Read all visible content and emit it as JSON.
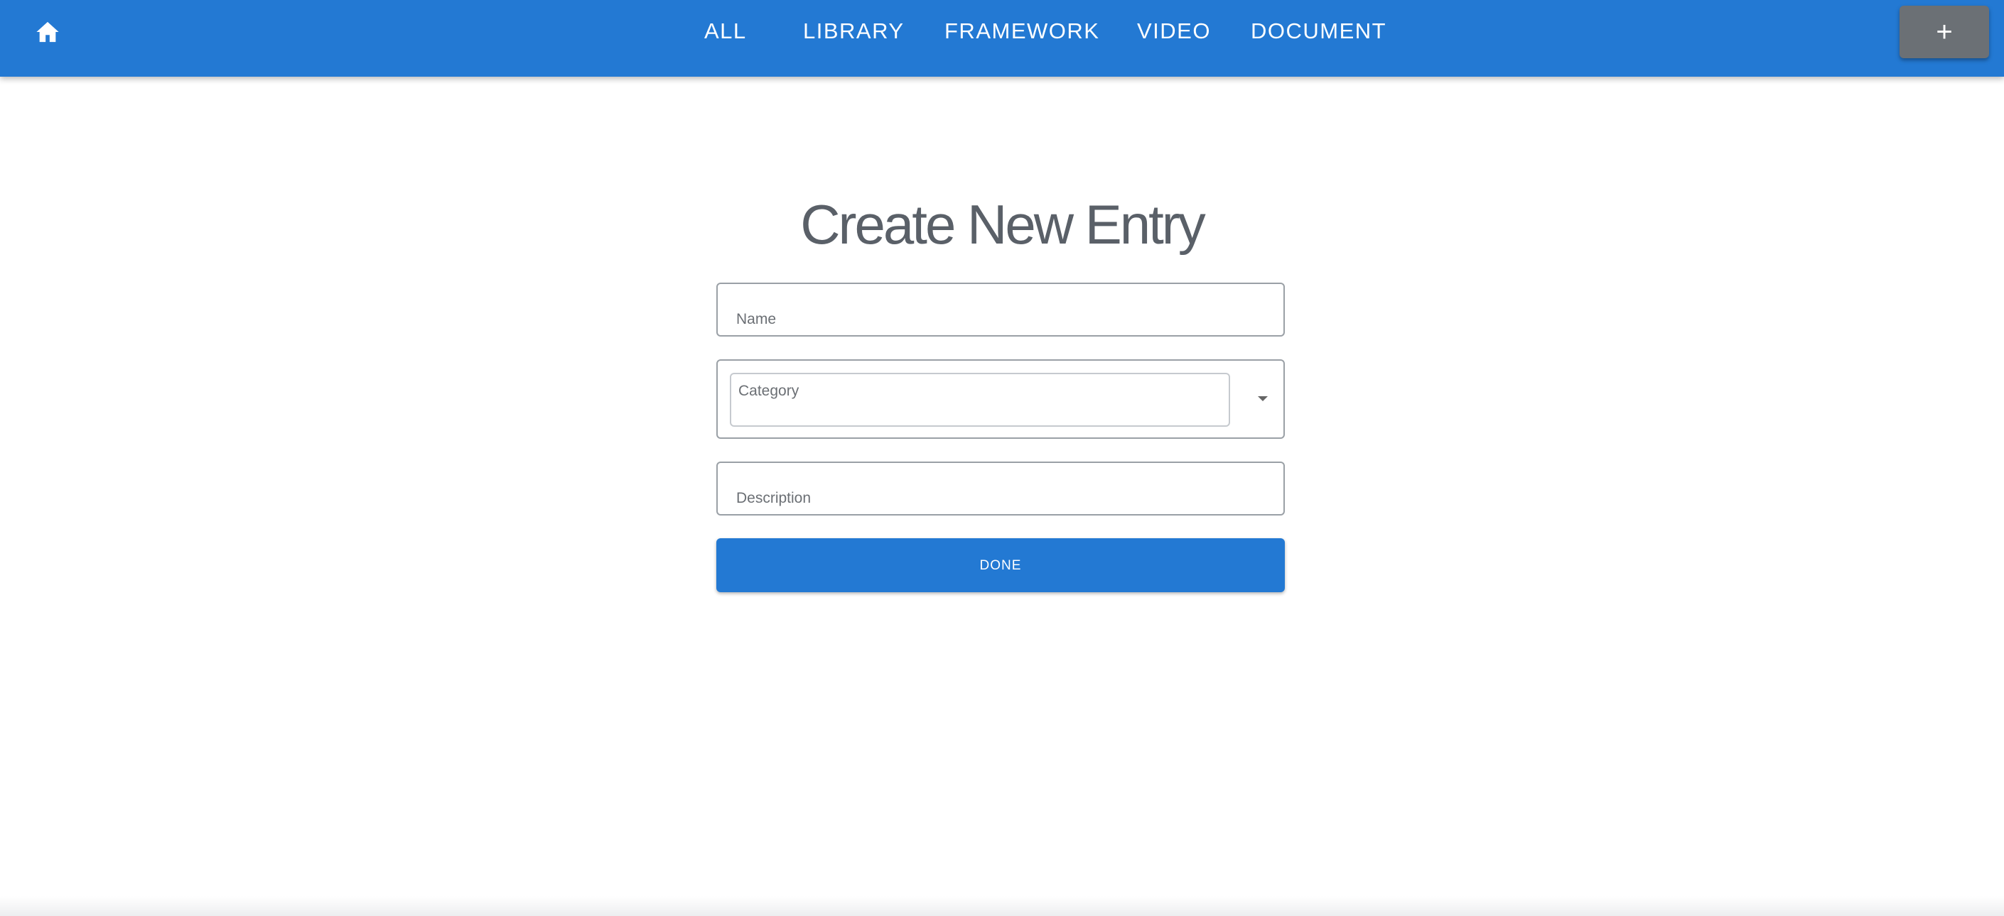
{
  "navbar": {
    "home_icon": "home-icon",
    "tabs": [
      {
        "label": "ALL"
      },
      {
        "label": "LIBRARY"
      },
      {
        "label": "FRAMEWORK"
      },
      {
        "label": "VIDEO"
      },
      {
        "label": "DOCUMENT"
      }
    ],
    "add_label": "+"
  },
  "form": {
    "title": "Create New Entry",
    "name_placeholder": "Name",
    "category_label": "Category",
    "description_placeholder": "Description",
    "done_label": "DONE"
  },
  "colors": {
    "primary": "#2379d3",
    "add_button": "#6b7075",
    "title_text": "#5a6068"
  }
}
